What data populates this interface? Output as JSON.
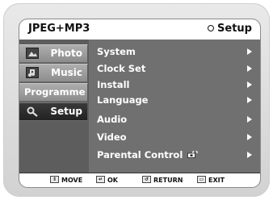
{
  "header": {
    "title": "JPEG+MP3",
    "mode_label": "Setup"
  },
  "sidebar": {
    "tabs": [
      {
        "label": "Photo",
        "icon": "photo-icon",
        "active": false
      },
      {
        "label": "Music",
        "icon": "music-icon",
        "active": false
      },
      {
        "label": "Programme",
        "icon": "",
        "active": false
      },
      {
        "label": "Setup",
        "icon": "setup-icon",
        "active": true
      }
    ]
  },
  "menu": {
    "items": [
      {
        "label": "System"
      },
      {
        "label": "Clock Set"
      },
      {
        "label": "Install"
      },
      {
        "label": "Language"
      },
      {
        "label": "Audio"
      },
      {
        "label": "Video"
      },
      {
        "label": "Parental Control"
      }
    ]
  },
  "footer": {
    "move": "MOVE",
    "ok": "OK",
    "return": "RETURN",
    "exit": "EXIT"
  },
  "colors": {
    "screen_bg": "#6a6a6a",
    "active_tab": "#2a2a2a",
    "tab": "#9c9c9c"
  }
}
